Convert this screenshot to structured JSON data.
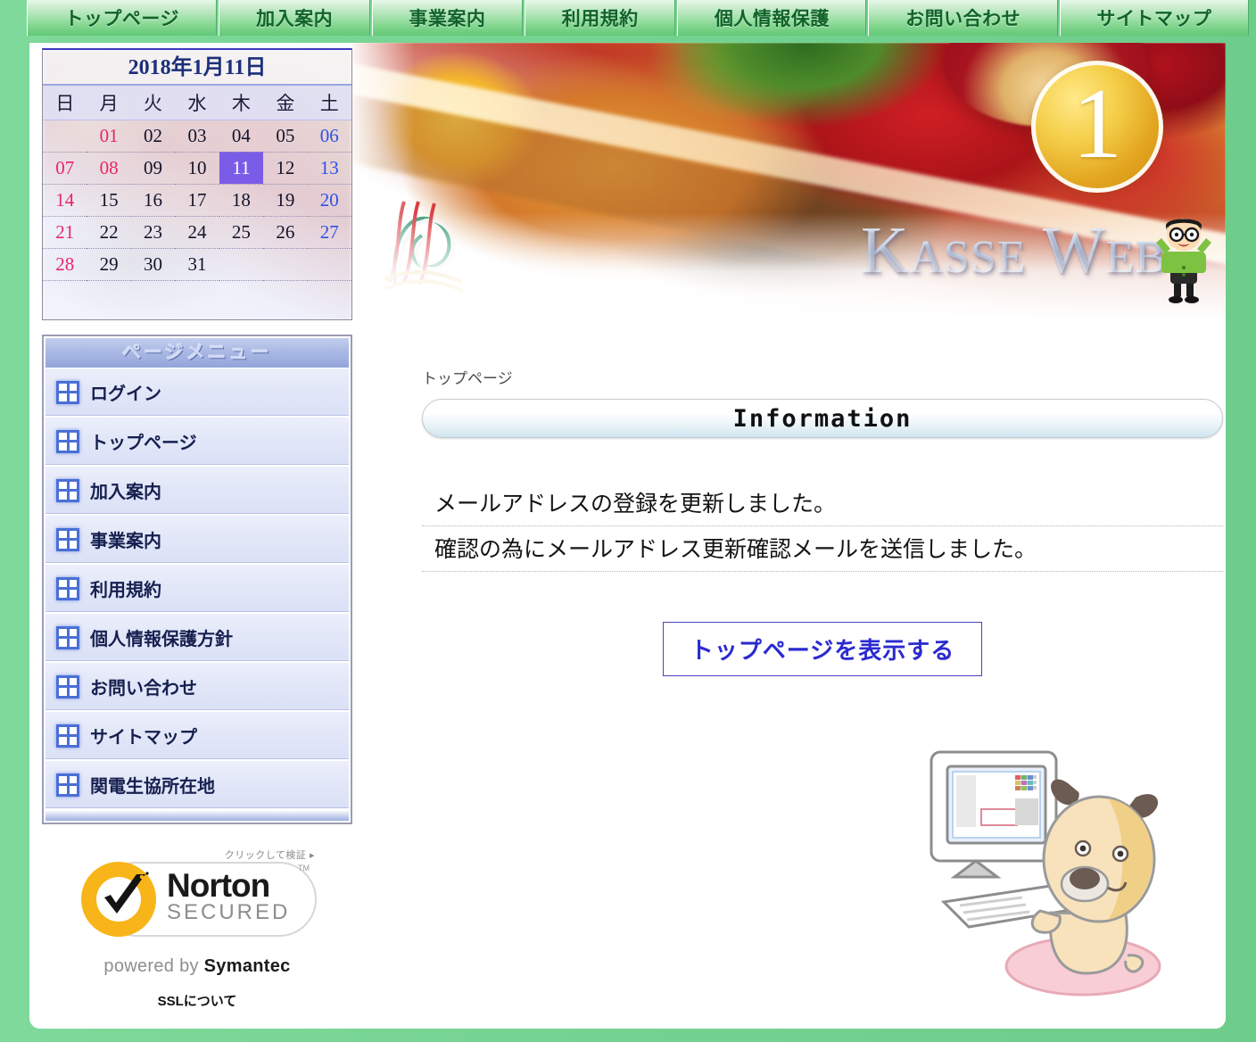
{
  "topnav": {
    "items": [
      {
        "label": "トップページ",
        "name": "nav-top-page"
      },
      {
        "label": "加入案内",
        "name": "nav-join-guide"
      },
      {
        "label": "事業案内",
        "name": "nav-business-guide"
      },
      {
        "label": "利用規約",
        "name": "nav-terms"
      },
      {
        "label": "個人情報保護",
        "name": "nav-privacy"
      },
      {
        "label": "お問い合わせ",
        "name": "nav-contact"
      },
      {
        "label": "サイトマップ",
        "name": "nav-sitemap"
      }
    ]
  },
  "banner": {
    "wordmark": "Kasse Web",
    "month_badge": "1"
  },
  "calendar": {
    "title": "2018年1月11日",
    "weekdays": [
      "日",
      "月",
      "火",
      "水",
      "木",
      "金",
      "土"
    ],
    "today": "11",
    "today_bg": "#7b5ce8",
    "sunday_color": "#e8256b",
    "saturday_color": "#2b53e8",
    "weeks": [
      [
        {
          "d": "",
          "t": "empty"
        },
        {
          "d": "01",
          "t": "hol"
        },
        {
          "d": "02",
          "t": "wd"
        },
        {
          "d": "03",
          "t": "wd"
        },
        {
          "d": "04",
          "t": "wd"
        },
        {
          "d": "05",
          "t": "wd"
        },
        {
          "d": "06",
          "t": "sat"
        }
      ],
      [
        {
          "d": "07",
          "t": "sun"
        },
        {
          "d": "08",
          "t": "hol"
        },
        {
          "d": "09",
          "t": "wd"
        },
        {
          "d": "10",
          "t": "wd"
        },
        {
          "d": "11",
          "t": "today"
        },
        {
          "d": "12",
          "t": "wd"
        },
        {
          "d": "13",
          "t": "sat"
        }
      ],
      [
        {
          "d": "14",
          "t": "sun"
        },
        {
          "d": "15",
          "t": "wd"
        },
        {
          "d": "16",
          "t": "wd"
        },
        {
          "d": "17",
          "t": "wd"
        },
        {
          "d": "18",
          "t": "wd"
        },
        {
          "d": "19",
          "t": "wd"
        },
        {
          "d": "20",
          "t": "sat"
        }
      ],
      [
        {
          "d": "21",
          "t": "sun"
        },
        {
          "d": "22",
          "t": "wd"
        },
        {
          "d": "23",
          "t": "wd"
        },
        {
          "d": "24",
          "t": "wd"
        },
        {
          "d": "25",
          "t": "wd"
        },
        {
          "d": "26",
          "t": "wd"
        },
        {
          "d": "27",
          "t": "sat"
        }
      ],
      [
        {
          "d": "28",
          "t": "sun"
        },
        {
          "d": "29",
          "t": "wd"
        },
        {
          "d": "30",
          "t": "wd"
        },
        {
          "d": "31",
          "t": "wd"
        },
        {
          "d": "",
          "t": "empty"
        },
        {
          "d": "",
          "t": "empty"
        },
        {
          "d": "",
          "t": "empty"
        }
      ]
    ]
  },
  "pagemenu": {
    "title": "ページメニュー",
    "items": [
      {
        "label": "ログイン",
        "name": "menu-item-login"
      },
      {
        "label": "トップページ",
        "name": "menu-item-top-page"
      },
      {
        "label": "加入案内",
        "name": "menu-item-join-guide"
      },
      {
        "label": "事業案内",
        "name": "menu-item-business-guide"
      },
      {
        "label": "利用規約",
        "name": "menu-item-terms"
      },
      {
        "label": "個人情報保護方針",
        "name": "menu-item-privacy-policy"
      },
      {
        "label": "お問い合わせ",
        "name": "menu-item-contact"
      },
      {
        "label": "サイトマップ",
        "name": "menu-item-sitemap"
      },
      {
        "label": "関電生協所在地",
        "name": "menu-item-location"
      }
    ]
  },
  "norton": {
    "click_to_verify": "クリックして検証 ▸",
    "brand": "Norton",
    "secured": "SECURED",
    "trademark": "TM",
    "powered_prefix": "powered by ",
    "powered_brand": "Symantec",
    "ssl_link": "SSLについて"
  },
  "main": {
    "breadcrumb": "トップページ",
    "heading": "Information",
    "messages": [
      "メールアドレスの登録を更新しました。",
      "確認の為にメールアドレス更新確認メールを送信しました。"
    ],
    "primary_button": "トップページを表示する"
  },
  "colors": {
    "page_background": "#76d492",
    "nav_text": "#11632a",
    "menu_text": "#16204f",
    "button_text": "#2a2ad0",
    "badge_gold": "#e3a51f"
  }
}
